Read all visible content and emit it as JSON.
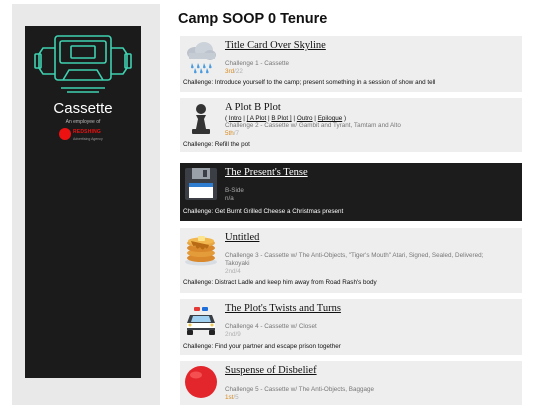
{
  "sidebar": {
    "name": "Cassette",
    "employee_of": "An employee of",
    "company_name": "REDSHING",
    "company_sub": "Advertising Agency",
    "logo_icon": "cassette-robot-icon",
    "logo_color": "#3fd1b0"
  },
  "page": {
    "title": "Camp SOOP 0 Tenure"
  },
  "colors": {
    "place": "#d78a1e",
    "muted": "#b0b0b0",
    "dark_card": "#1c1c1c",
    "card": "#eeeeee"
  },
  "cards": [
    {
      "icon": "rain-cloud-icon",
      "title": "Title Card Over Skyline",
      "line1": "Challenge 1 - Cassette",
      "place": "3rd",
      "total": "/22",
      "challenge": "Challenge: Introduce yourself to the camp; present something in a session of show and tell"
    },
    {
      "icon": "chess-pawn-icon",
      "title": "A Plot B Plot",
      "links": {
        "open": "( ",
        "intro": "Intro",
        "sep1": " | ",
        "aplot": "[ A Plot",
        "sep2": " | ",
        "bplot": "B Plot ]",
        "sep3": " | ",
        "outro": "Outro",
        "sep4": " | ",
        "epilogue": "Epilogue",
        "close": " )"
      },
      "line1": "Challenge 2 - Cassette w/ Gambit and Tyrant, Tamtam and Alto",
      "place": "5th",
      "total": "/7",
      "challenge": "Challenge: Refill the pot"
    },
    {
      "icon": "floppy-disk-icon",
      "title": "The Present's Tense",
      "line1": "B-Side",
      "line2": "n/a",
      "challenge": "Challenge: Get Burnt Grilled Cheese a Christmas present"
    },
    {
      "icon": "pancakes-icon",
      "title": "Untitled",
      "line1": "Challenge 3 - Cassette w/ The Anti-Objects, \"Tiger's Mouth\" Atari, Signed, Sealed, Delivered;",
      "line1b": "Takoyaki",
      "place": "2nd",
      "total": "/4",
      "challenge": "Challenge: Distract Ladle and keep him away from Road Rash's body"
    },
    {
      "icon": "police-car-icon",
      "title": "The Plot's Twists and Turns",
      "line1": "Challenge 4 - Cassette w/ Closet",
      "place": "2nd",
      "total": "/9",
      "challenge": "Challenge: Find your partner and escape prison together"
    },
    {
      "icon": "red-circle-icon",
      "title": "Suspense of Disbelief",
      "line1": "Challenge 5 - Cassette w/ The Anti-Objects, Baggage",
      "place": "1st",
      "total": "/5"
    }
  ]
}
